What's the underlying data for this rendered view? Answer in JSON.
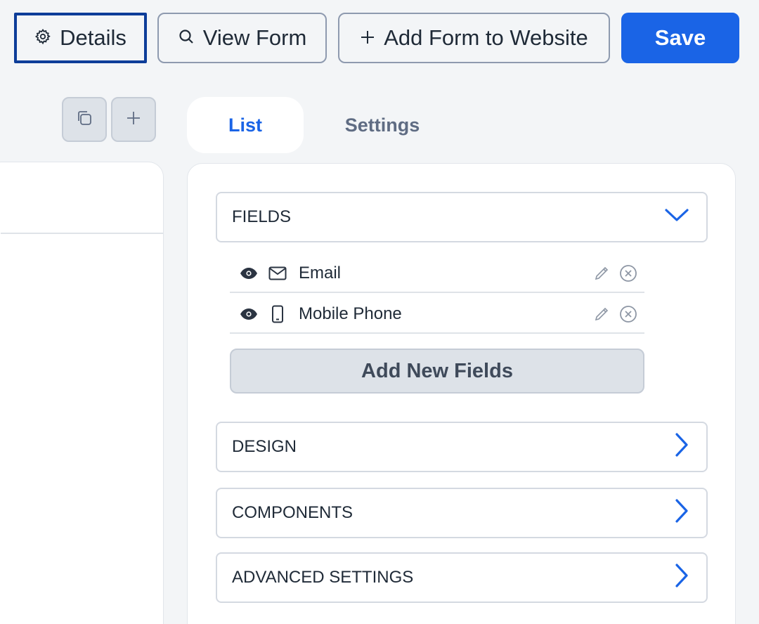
{
  "toolbar": {
    "details_label": "Details",
    "view_form_label": "View Form",
    "add_to_website_label": "Add Form to Website",
    "save_label": "Save"
  },
  "tabs": [
    {
      "label": "List",
      "active": true
    },
    {
      "label": "Settings",
      "active": false
    }
  ],
  "fields_section": {
    "title": "FIELDS",
    "expanded": true,
    "items": [
      {
        "label": "Email",
        "icon": "mail-icon"
      },
      {
        "label": "Mobile Phone",
        "icon": "mobile-phone-icon"
      }
    ],
    "add_button_label": "Add New Fields"
  },
  "sections": [
    {
      "title": "DESIGN"
    },
    {
      "title": "COMPONENTS"
    },
    {
      "title": "ADVANCED SETTINGS"
    }
  ],
  "colors": {
    "accent": "#1a64e6",
    "focus_border": "#0d3d99",
    "background": "#f3f5f7"
  }
}
